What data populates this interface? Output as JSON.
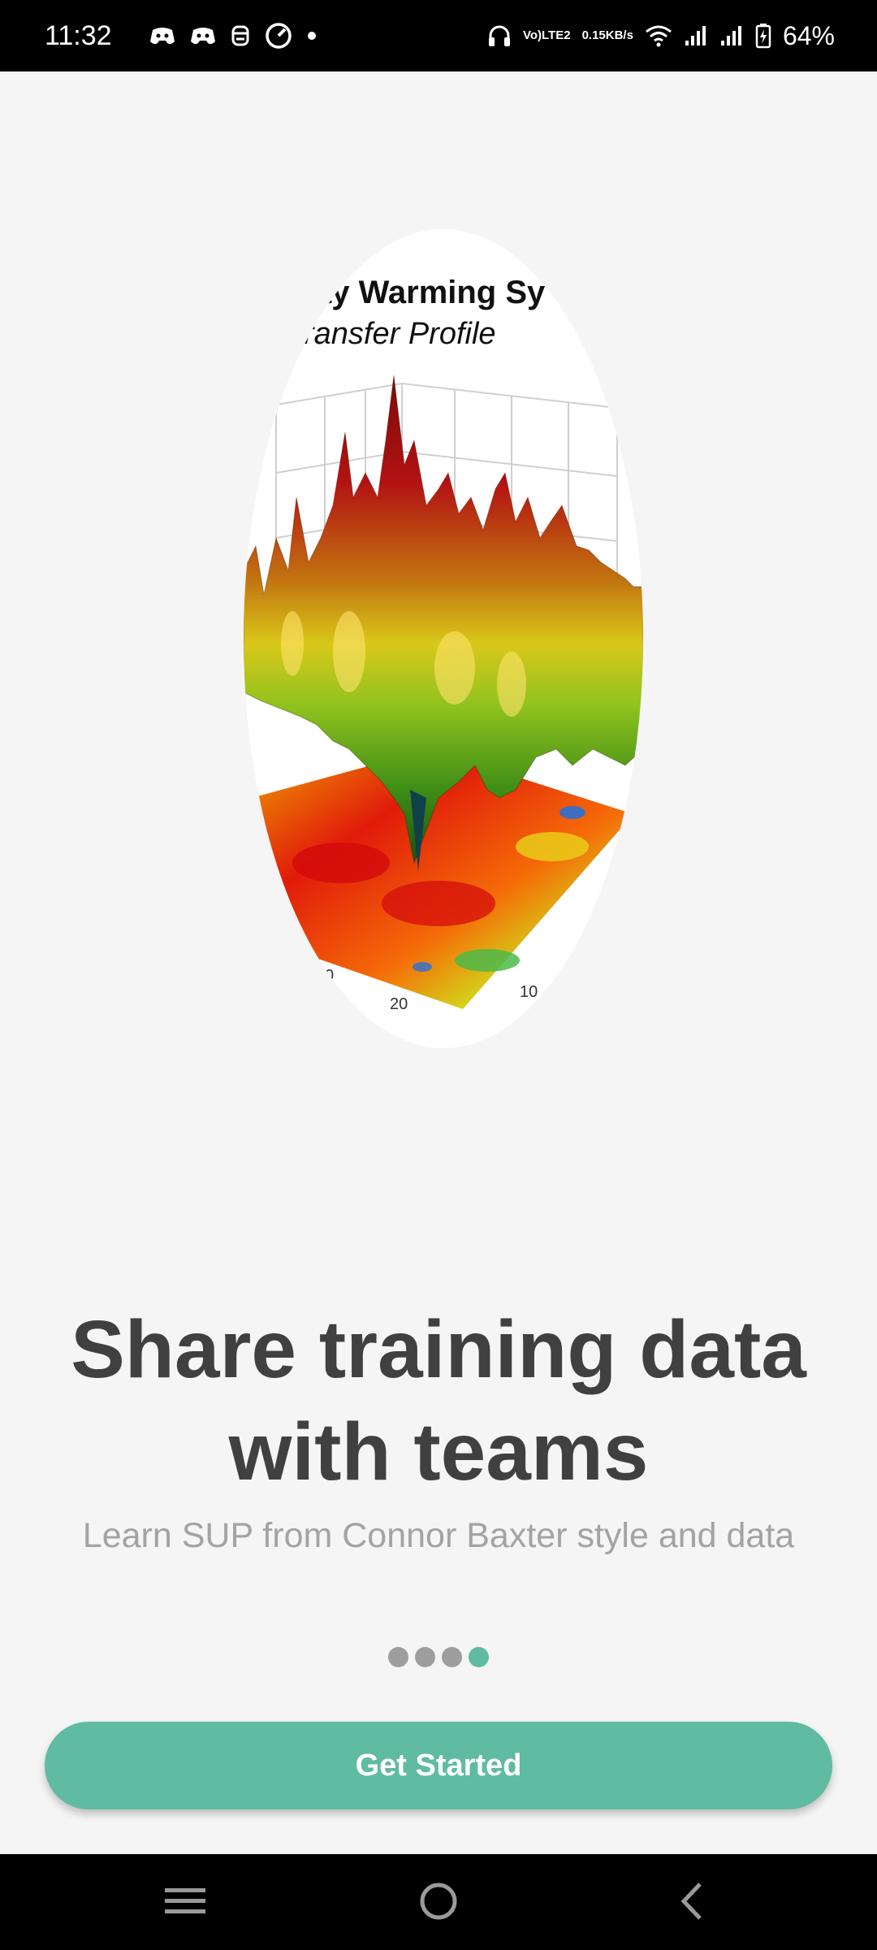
{
  "status_bar": {
    "time": "11:32",
    "network_label_top": "Vo)",
    "network_label_bottom": "LTE2",
    "speed_value": "0.15",
    "speed_unit": "KB/s",
    "battery": "64%",
    "icons": [
      "discord-icon",
      "discord-icon",
      "mask-icon",
      "speedometer-icon",
      "dot-icon",
      "headphones-icon",
      "wifi-icon",
      "signal-icon",
      "signal-icon",
      "battery-charging-icon"
    ]
  },
  "hero": {
    "title": "ay Warming Sy",
    "subtitle": "ransfer Profile",
    "axis_label_a": "0",
    "axis_label_b": "20",
    "axis_label_c": "10"
  },
  "headline": {
    "line1": "Share training data",
    "line2": "with teams"
  },
  "subheadline": "Learn SUP from Connor Baxter style and data",
  "pagination": {
    "total": 4,
    "active": 4
  },
  "cta": {
    "label": "Get Started",
    "color": "#5fbba1"
  },
  "nav_bar": {
    "icons": [
      "menu-icon",
      "home-icon",
      "back-icon"
    ]
  }
}
